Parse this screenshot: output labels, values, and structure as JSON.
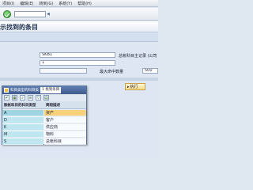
{
  "menu": [
    "项目(I)",
    "编辑(E)",
    "转到(G)",
    "系统(Y)",
    "帮助(H)"
  ],
  "title": "示找到的条目",
  "fields": {
    "table_value": "SKB1",
    "value_two": "1",
    "label_max": "总帐科目主记录 (公司",
    "label_maxhits": "最大命中数量",
    "max_hits": "500"
  },
  "execute_button": "执行",
  "popup": {
    "tab1": "科目类型的科目类",
    "tab2": "1 找到条目",
    "headers": [
      "账帐科目的科目类型",
      "简短描述"
    ],
    "rows": [
      {
        "code": "A",
        "desc": "资产"
      },
      {
        "code": "D",
        "desc": "客户"
      },
      {
        "code": "K",
        "desc": "供应商"
      },
      {
        "code": "M",
        "desc": "物料"
      },
      {
        "code": "S",
        "desc": "总帐科目"
      }
    ]
  }
}
